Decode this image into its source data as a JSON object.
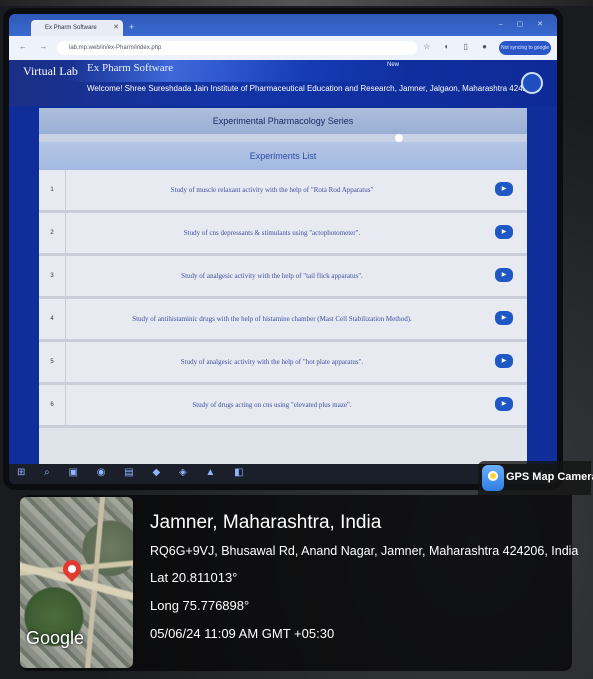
{
  "browser": {
    "tab_title": "Ex Pharm Software",
    "url": "lab.mp.web/in/ex-Pharm/index.php",
    "profile_label": "Not syncing to google"
  },
  "site": {
    "brand": "Virtual Lab",
    "app_name": "Ex Pharm Software",
    "user": "New",
    "welcome": "Welcome!  Shree Sureshdada Jain Institute of Pharmaceutical Education and Research, Jamner, Jalgaon, Maharashtra 424206."
  },
  "content": {
    "series_title": "Experimental Pharmacology Series",
    "list_title": "Experiments List",
    "experiments": [
      {
        "num": "1",
        "title": "Study of muscle relaxant activity with the help of \"Rota Rod Apparatus\""
      },
      {
        "num": "2",
        "title": "Study of cns depressants & stimulants using \"actophotometer\"."
      },
      {
        "num": "3",
        "title": "Study of analgesic activity with the help of \"tail flick apparatus\"."
      },
      {
        "num": "4",
        "title": "Study of antihistaminic drugs with the help of histamine chamber (Mast Cell Stabilization Method)."
      },
      {
        "num": "5",
        "title": "Study of analgesic activity with the help of \"hot plate apparatus\"."
      },
      {
        "num": "6",
        "title": "Study of drugs acting on cns using \"elevated plus maze\"."
      }
    ]
  },
  "overlay": {
    "app_name": "GPS Map Camera",
    "map_logo": "Google",
    "location": "Jamner, Maharashtra, India",
    "address": "RQ6G+9VJ, Bhusawal Rd, Anand Nagar, Jamner, Maharashtra 424206, India",
    "lat": "Lat 20.811013°",
    "long": "Long 75.776898°",
    "datetime": "05/06/24 11:09 AM GMT +05:30"
  },
  "icons": {
    "map_pin": "map-pin-icon",
    "camera": "gps-camera-icon",
    "go": "play-circle-icon"
  },
  "colors": {
    "lab_header": "#1234a8",
    "go_button": "#1f58c4",
    "map_pin": "#e23a2e"
  }
}
